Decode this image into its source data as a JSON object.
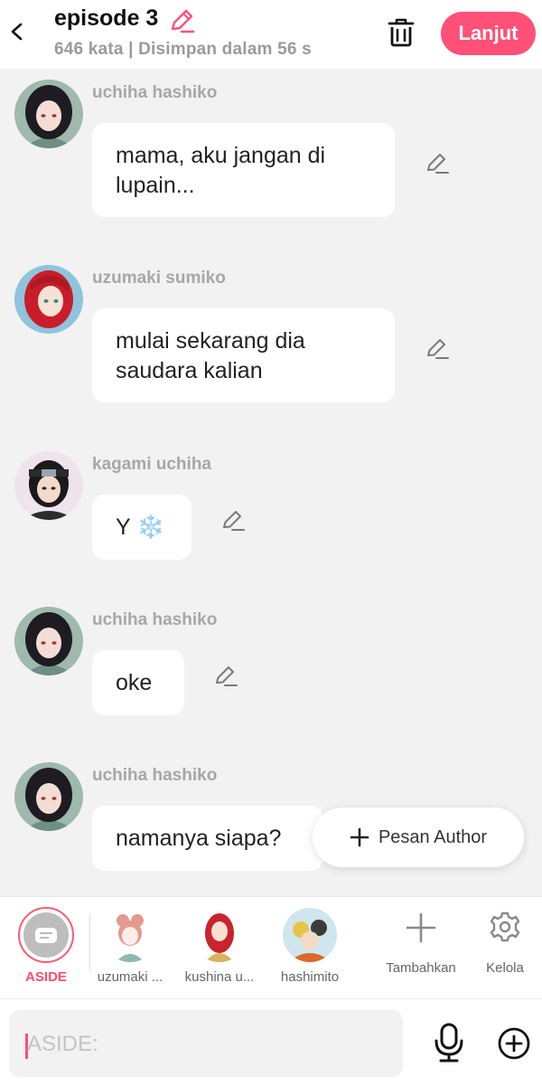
{
  "header": {
    "title": "episode 3",
    "subtitle": "646 kata | Disimpan dalam 56 s",
    "next_label": "Lanjut",
    "accent_color": "#ff5177"
  },
  "messages": [
    {
      "sender": "uchiha hashiko",
      "text": "mama, aku jangan di lupain...",
      "avatar": "dark-haired-girl-avatar"
    },
    {
      "sender": "uzumaki sumiko",
      "text": "mulai sekarang dia saudara kalian",
      "avatar": "red-haired-girl-avatar"
    },
    {
      "sender": "kagami uchiha",
      "text": "Y ❄️",
      "avatar": "headband-boy-avatar"
    },
    {
      "sender": "uchiha hashiko",
      "text": "oke",
      "avatar": "dark-haired-girl-avatar"
    },
    {
      "sender": "uchiha hashiko",
      "text": "namanya siapa?",
      "avatar": "dark-haired-girl-avatar"
    }
  ],
  "floating": {
    "pesan_author_label": "Pesan Author"
  },
  "characters": [
    {
      "label": "ASIDE",
      "selected": true
    },
    {
      "label": "uzumaki ..."
    },
    {
      "label": "kushina u..."
    },
    {
      "label": "hashimito"
    },
    {
      "label": "Tambahkan",
      "icon": "plus-icon"
    },
    {
      "label": "Kelola",
      "icon": "gear-icon"
    }
  ],
  "input": {
    "placeholder": "ASIDE:"
  }
}
